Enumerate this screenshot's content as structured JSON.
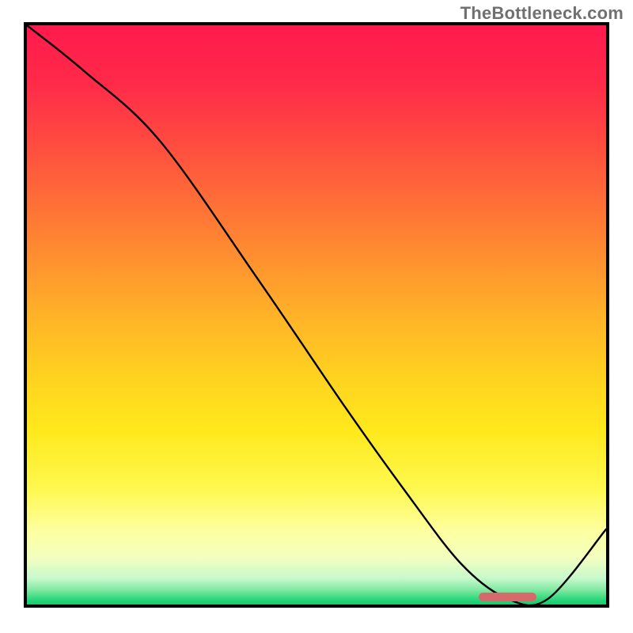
{
  "watermark": "TheBottleneck.com",
  "chart_data": {
    "type": "line",
    "title": "",
    "xlabel": "",
    "ylabel": "",
    "xlim": [
      0,
      1
    ],
    "ylim": [
      0,
      1
    ],
    "series": [
      {
        "name": "curve",
        "x": [
          0.0,
          0.1,
          0.23,
          0.4,
          0.55,
          0.65,
          0.75,
          0.83,
          0.9,
          1.0
        ],
        "values": [
          1.0,
          0.92,
          0.8,
          0.56,
          0.34,
          0.2,
          0.07,
          0.01,
          0.01,
          0.13
        ]
      }
    ],
    "marker": {
      "x": 0.78,
      "width": 0.1,
      "y": 0.005,
      "color": "#d66a6a"
    },
    "background_gradient": {
      "stops": [
        {
          "pos": 0.0,
          "color": "#ff1a4d"
        },
        {
          "pos": 0.1,
          "color": "#ff2a49"
        },
        {
          "pos": 0.2,
          "color": "#ff4a40"
        },
        {
          "pos": 0.3,
          "color": "#ff6d38"
        },
        {
          "pos": 0.4,
          "color": "#ff8f30"
        },
        {
          "pos": 0.5,
          "color": "#ffb228"
        },
        {
          "pos": 0.6,
          "color": "#ffd020"
        },
        {
          "pos": 0.7,
          "color": "#ffe91c"
        },
        {
          "pos": 0.8,
          "color": "#fff850"
        },
        {
          "pos": 0.87,
          "color": "#fdff9c"
        },
        {
          "pos": 0.92,
          "color": "#f3ffc0"
        },
        {
          "pos": 0.955,
          "color": "#c7f9cc"
        },
        {
          "pos": 0.975,
          "color": "#7ee8a0"
        },
        {
          "pos": 0.99,
          "color": "#2fd87d"
        },
        {
          "pos": 1.0,
          "color": "#18c96e"
        }
      ]
    }
  }
}
